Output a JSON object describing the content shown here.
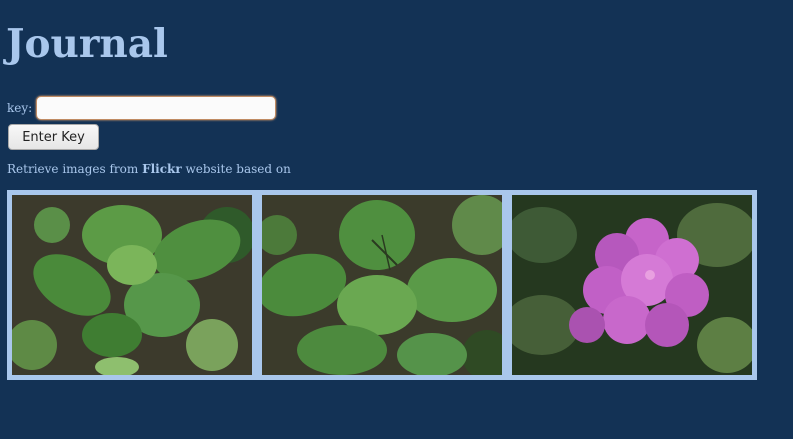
{
  "page": {
    "title": "Journal"
  },
  "form": {
    "key_label": "key:",
    "key_value": "",
    "submit_label": "Enter Key"
  },
  "description": {
    "prefix": "Retrieve images from ",
    "brand": "Flickr",
    "suffix": " website based on"
  },
  "gallery": {
    "images": [
      {
        "subject": "nettle plant from above",
        "dominant_color": "#4f8f3f"
      },
      {
        "subject": "nettle plant with insect",
        "dominant_color": "#4d8a3e"
      },
      {
        "subject": "pink rhododendron flower",
        "dominant_color": "#c664c9"
      }
    ]
  },
  "colors": {
    "background": "#133255",
    "text": "#a9c7ec",
    "gallery_border": "#a9c7ec"
  }
}
